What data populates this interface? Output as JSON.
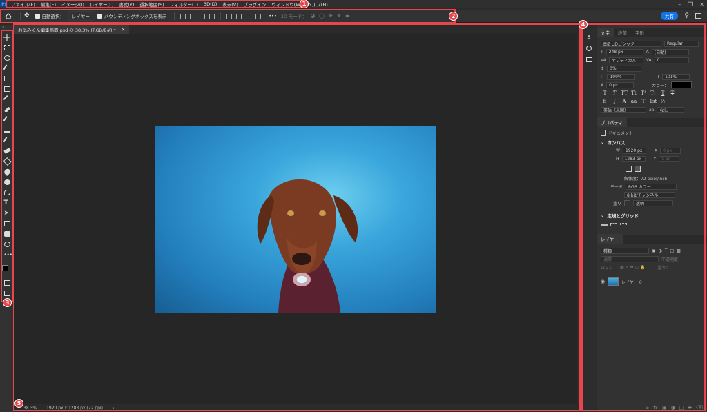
{
  "app": {
    "logo": "Ps"
  },
  "menubar": {
    "items": [
      "ファイル(F)",
      "編集(E)",
      "イメージ(I)",
      "レイヤー(L)",
      "書式(Y)",
      "選択範囲(S)",
      "フィルター(T)",
      "3D(D)",
      "表示(V)",
      "プラグイン",
      "ウィンドウ(W)",
      "ヘルプ(H)"
    ]
  },
  "optbar": {
    "auto_select_label": "自動選択：",
    "auto_select_target": "レイヤー",
    "bounding_box_label": "バウンディングボックスを表示",
    "mode_3d_label": "3D モード：",
    "share_label": "共有"
  },
  "document": {
    "tab_title": "お似みくん編集画面.psd @ 38.3% (RGB/8#) *",
    "status_zoom": "38.3%",
    "status_info": "1920 px x 1283 px (72 ppi)"
  },
  "char_panel": {
    "tabs": [
      "文字",
      "段落",
      "字形"
    ],
    "font_family": "BIZ UDゴシック",
    "font_style": "Regular",
    "font_size": "248 px",
    "leading": "(自動)",
    "kerning": "オプティカル",
    "tracking": "0",
    "tsume": "0%",
    "vert_scale": "100%",
    "horiz_scale": "101%",
    "baseline": "0 px",
    "color_label": "カラー：",
    "color_value": "#000000",
    "language": "英語（米国）",
    "aa": "なし"
  },
  "properties_panel": {
    "tab": "プロパティ",
    "doc_label": "ドキュメント",
    "canvas_title": "カンバス",
    "w_label": "W",
    "w_value": "1920 px",
    "x_label": "X",
    "x_value": "0 px",
    "h_label": "H",
    "h_value": "1283 px",
    "y_label": "Y",
    "y_value": "0 px",
    "resolution": "解像度：72 pixel/inch",
    "mode_label": "モード",
    "mode_value": "RGB カラー",
    "bit_value": "8 bit/チャンネル",
    "fill_label": "塗り",
    "fill_value": "透明",
    "guides_title": "定規とグリッド"
  },
  "layers_panel": {
    "tab": "レイヤー",
    "filter_kind": "種類",
    "blend_mode": "通常",
    "opacity_label": "不透明度：",
    "lock_label": "ロック：",
    "fill_label": "塗り：",
    "layer_name": "レイヤー 0"
  },
  "annotations": [
    "1",
    "2",
    "3",
    "4",
    "5"
  ],
  "colors": {
    "annotation_red": "#e8464b",
    "share_blue": "#1473e6",
    "ps_blue": "#31a8ff"
  }
}
